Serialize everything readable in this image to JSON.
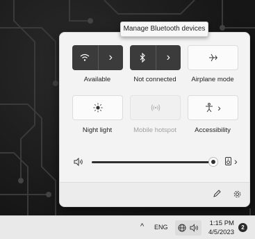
{
  "tooltip": "Manage Bluetooth devices",
  "quick_settings": {
    "tiles": [
      {
        "id": "wifi",
        "label": "Available",
        "icon": "wifi-icon",
        "state": "on"
      },
      {
        "id": "bluetooth",
        "label": "Not connected",
        "icon": "bluetooth-icon",
        "state": "on"
      },
      {
        "id": "airplane",
        "label": "Airplane mode",
        "icon": "airplane-icon",
        "state": "off"
      },
      {
        "id": "night_light",
        "label": "Night light",
        "icon": "brightness-icon",
        "state": "off"
      },
      {
        "id": "hotspot",
        "label": "Mobile hotspot",
        "icon": "hotspot-icon",
        "state": "disabled"
      },
      {
        "id": "accessibility",
        "label": "Accessibility",
        "icon": "accessibility-icon",
        "state": "off"
      }
    ],
    "arrow_glyph": "›",
    "volume": {
      "level": 0.98,
      "icon": "speaker-icon",
      "output_icon": "audio-output-icon"
    },
    "footer": {
      "edit_icon": "pencil-icon",
      "settings_icon": "gear-icon"
    }
  },
  "taskbar": {
    "overflow_glyph": "^",
    "language": "ENG",
    "network_icon": "globe-icon",
    "volume_icon": "speaker-icon",
    "time": "1:15 PM",
    "date": "4/5/2023",
    "notifications": "2"
  },
  "colors": {
    "tile_active": "#3b3b3b",
    "panel_bg": "#f3f3f3",
    "taskbar_bg": "#e9e9e9"
  }
}
